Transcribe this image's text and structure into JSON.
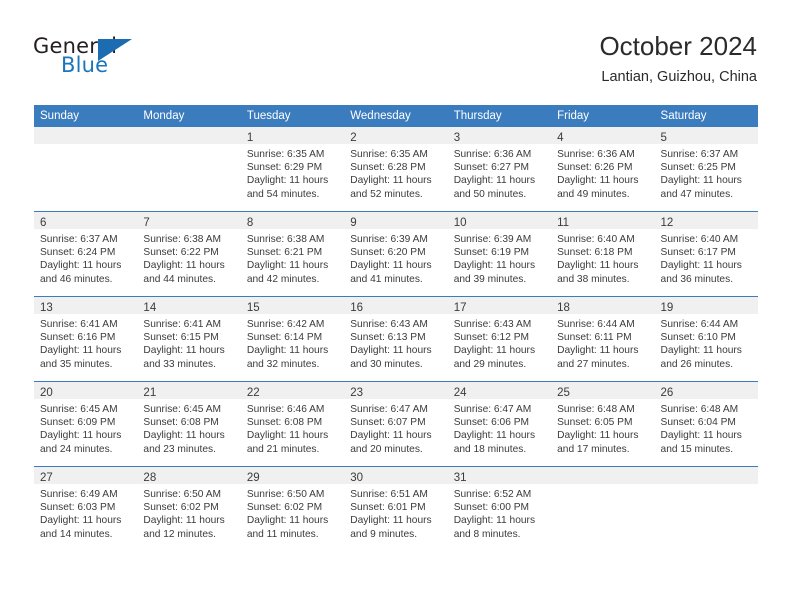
{
  "brand": {
    "word_general": "General",
    "word_blue": "Blue",
    "logo_color": "#1b6cb0"
  },
  "header": {
    "title": "October 2024",
    "location": "Lantian, Guizhou, China"
  },
  "theme": {
    "header_blue": "#3a7cbe",
    "band_gray": "#f0f0f0",
    "text": "#3b3b3b"
  },
  "weekdays": [
    "Sunday",
    "Monday",
    "Tuesday",
    "Wednesday",
    "Thursday",
    "Friday",
    "Saturday"
  ],
  "weeks": [
    [
      {
        "day": "",
        "empty": true
      },
      {
        "day": "",
        "empty": true
      },
      {
        "day": "1",
        "sunrise": "Sunrise: 6:35 AM",
        "sunset": "Sunset: 6:29 PM",
        "daylight1": "Daylight: 11 hours",
        "daylight2": "and 54 minutes."
      },
      {
        "day": "2",
        "sunrise": "Sunrise: 6:35 AM",
        "sunset": "Sunset: 6:28 PM",
        "daylight1": "Daylight: 11 hours",
        "daylight2": "and 52 minutes."
      },
      {
        "day": "3",
        "sunrise": "Sunrise: 6:36 AM",
        "sunset": "Sunset: 6:27 PM",
        "daylight1": "Daylight: 11 hours",
        "daylight2": "and 50 minutes."
      },
      {
        "day": "4",
        "sunrise": "Sunrise: 6:36 AM",
        "sunset": "Sunset: 6:26 PM",
        "daylight1": "Daylight: 11 hours",
        "daylight2": "and 49 minutes."
      },
      {
        "day": "5",
        "sunrise": "Sunrise: 6:37 AM",
        "sunset": "Sunset: 6:25 PM",
        "daylight1": "Daylight: 11 hours",
        "daylight2": "and 47 minutes."
      }
    ],
    [
      {
        "day": "6",
        "sunrise": "Sunrise: 6:37 AM",
        "sunset": "Sunset: 6:24 PM",
        "daylight1": "Daylight: 11 hours",
        "daylight2": "and 46 minutes."
      },
      {
        "day": "7",
        "sunrise": "Sunrise: 6:38 AM",
        "sunset": "Sunset: 6:22 PM",
        "daylight1": "Daylight: 11 hours",
        "daylight2": "and 44 minutes."
      },
      {
        "day": "8",
        "sunrise": "Sunrise: 6:38 AM",
        "sunset": "Sunset: 6:21 PM",
        "daylight1": "Daylight: 11 hours",
        "daylight2": "and 42 minutes."
      },
      {
        "day": "9",
        "sunrise": "Sunrise: 6:39 AM",
        "sunset": "Sunset: 6:20 PM",
        "daylight1": "Daylight: 11 hours",
        "daylight2": "and 41 minutes."
      },
      {
        "day": "10",
        "sunrise": "Sunrise: 6:39 AM",
        "sunset": "Sunset: 6:19 PM",
        "daylight1": "Daylight: 11 hours",
        "daylight2": "and 39 minutes."
      },
      {
        "day": "11",
        "sunrise": "Sunrise: 6:40 AM",
        "sunset": "Sunset: 6:18 PM",
        "daylight1": "Daylight: 11 hours",
        "daylight2": "and 38 minutes."
      },
      {
        "day": "12",
        "sunrise": "Sunrise: 6:40 AM",
        "sunset": "Sunset: 6:17 PM",
        "daylight1": "Daylight: 11 hours",
        "daylight2": "and 36 minutes."
      }
    ],
    [
      {
        "day": "13",
        "sunrise": "Sunrise: 6:41 AM",
        "sunset": "Sunset: 6:16 PM",
        "daylight1": "Daylight: 11 hours",
        "daylight2": "and 35 minutes."
      },
      {
        "day": "14",
        "sunrise": "Sunrise: 6:41 AM",
        "sunset": "Sunset: 6:15 PM",
        "daylight1": "Daylight: 11 hours",
        "daylight2": "and 33 minutes."
      },
      {
        "day": "15",
        "sunrise": "Sunrise: 6:42 AM",
        "sunset": "Sunset: 6:14 PM",
        "daylight1": "Daylight: 11 hours",
        "daylight2": "and 32 minutes."
      },
      {
        "day": "16",
        "sunrise": "Sunrise: 6:43 AM",
        "sunset": "Sunset: 6:13 PM",
        "daylight1": "Daylight: 11 hours",
        "daylight2": "and 30 minutes."
      },
      {
        "day": "17",
        "sunrise": "Sunrise: 6:43 AM",
        "sunset": "Sunset: 6:12 PM",
        "daylight1": "Daylight: 11 hours",
        "daylight2": "and 29 minutes."
      },
      {
        "day": "18",
        "sunrise": "Sunrise: 6:44 AM",
        "sunset": "Sunset: 6:11 PM",
        "daylight1": "Daylight: 11 hours",
        "daylight2": "and 27 minutes."
      },
      {
        "day": "19",
        "sunrise": "Sunrise: 6:44 AM",
        "sunset": "Sunset: 6:10 PM",
        "daylight1": "Daylight: 11 hours",
        "daylight2": "and 26 minutes."
      }
    ],
    [
      {
        "day": "20",
        "sunrise": "Sunrise: 6:45 AM",
        "sunset": "Sunset: 6:09 PM",
        "daylight1": "Daylight: 11 hours",
        "daylight2": "and 24 minutes."
      },
      {
        "day": "21",
        "sunrise": "Sunrise: 6:45 AM",
        "sunset": "Sunset: 6:08 PM",
        "daylight1": "Daylight: 11 hours",
        "daylight2": "and 23 minutes."
      },
      {
        "day": "22",
        "sunrise": "Sunrise: 6:46 AM",
        "sunset": "Sunset: 6:08 PM",
        "daylight1": "Daylight: 11 hours",
        "daylight2": "and 21 minutes."
      },
      {
        "day": "23",
        "sunrise": "Sunrise: 6:47 AM",
        "sunset": "Sunset: 6:07 PM",
        "daylight1": "Daylight: 11 hours",
        "daylight2": "and 20 minutes."
      },
      {
        "day": "24",
        "sunrise": "Sunrise: 6:47 AM",
        "sunset": "Sunset: 6:06 PM",
        "daylight1": "Daylight: 11 hours",
        "daylight2": "and 18 minutes."
      },
      {
        "day": "25",
        "sunrise": "Sunrise: 6:48 AM",
        "sunset": "Sunset: 6:05 PM",
        "daylight1": "Daylight: 11 hours",
        "daylight2": "and 17 minutes."
      },
      {
        "day": "26",
        "sunrise": "Sunrise: 6:48 AM",
        "sunset": "Sunset: 6:04 PM",
        "daylight1": "Daylight: 11 hours",
        "daylight2": "and 15 minutes."
      }
    ],
    [
      {
        "day": "27",
        "sunrise": "Sunrise: 6:49 AM",
        "sunset": "Sunset: 6:03 PM",
        "daylight1": "Daylight: 11 hours",
        "daylight2": "and 14 minutes."
      },
      {
        "day": "28",
        "sunrise": "Sunrise: 6:50 AM",
        "sunset": "Sunset: 6:02 PM",
        "daylight1": "Daylight: 11 hours",
        "daylight2": "and 12 minutes."
      },
      {
        "day": "29",
        "sunrise": "Sunrise: 6:50 AM",
        "sunset": "Sunset: 6:02 PM",
        "daylight1": "Daylight: 11 hours",
        "daylight2": "and 11 minutes."
      },
      {
        "day": "30",
        "sunrise": "Sunrise: 6:51 AM",
        "sunset": "Sunset: 6:01 PM",
        "daylight1": "Daylight: 11 hours",
        "daylight2": "and 9 minutes."
      },
      {
        "day": "31",
        "sunrise": "Sunrise: 6:52 AM",
        "sunset": "Sunset: 6:00 PM",
        "daylight1": "Daylight: 11 hours",
        "daylight2": "and 8 minutes."
      },
      {
        "day": "",
        "empty": true
      },
      {
        "day": "",
        "empty": true
      }
    ]
  ]
}
